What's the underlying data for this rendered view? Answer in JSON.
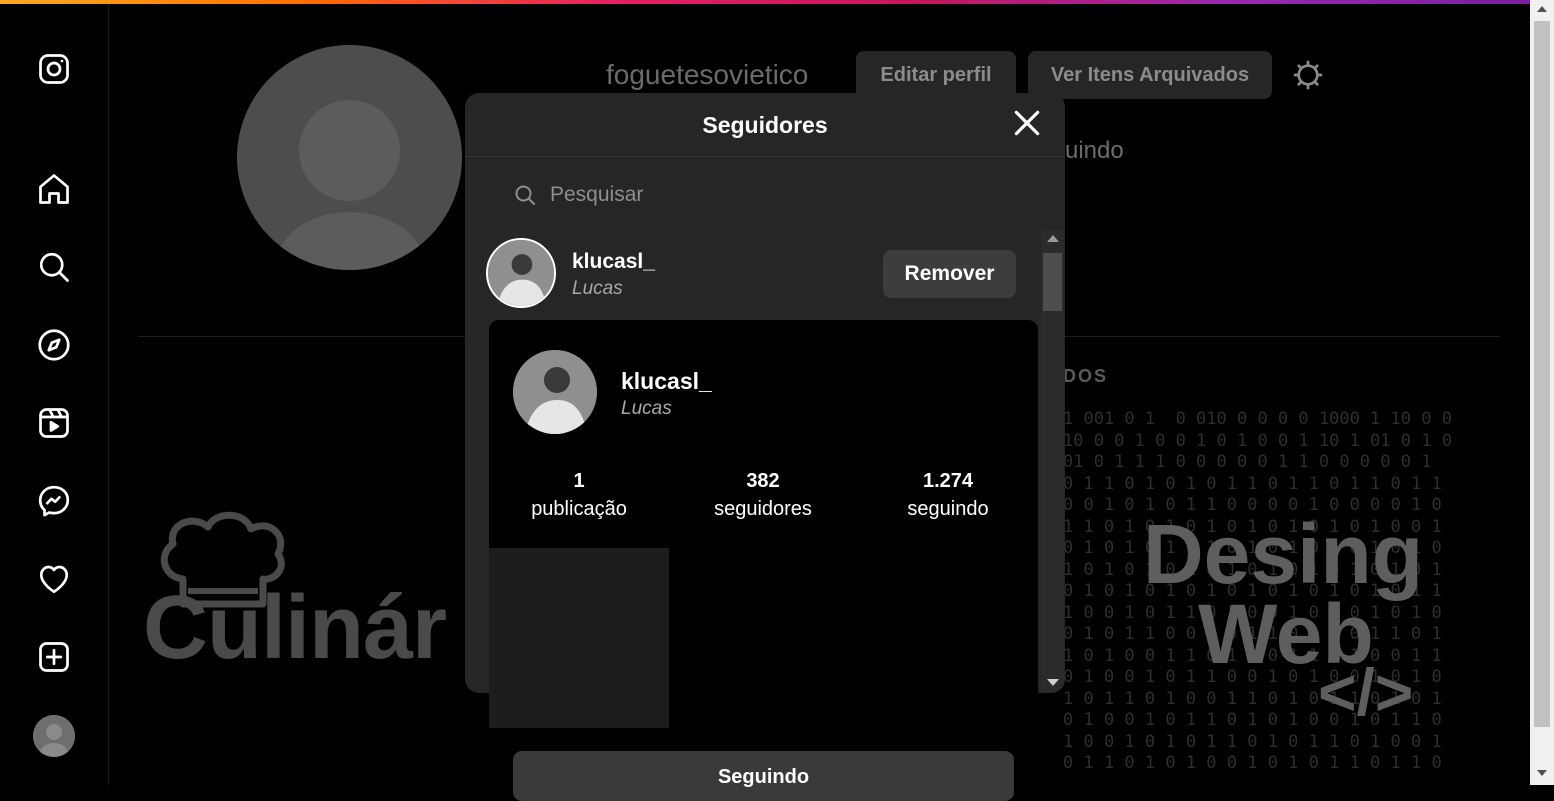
{
  "colors": {
    "background": "#000000",
    "modal": "#262626",
    "button": "#3d3d3d",
    "muted": "#a8a8a8"
  },
  "sidebar": {
    "icons": [
      "instagram-logo-icon",
      "home-icon",
      "search-icon",
      "explore-icon",
      "reels-icon",
      "messenger-icon",
      "heart-icon",
      "create-icon"
    ]
  },
  "profile": {
    "username": "foguetesovietico",
    "edit_label": "Editar perfil",
    "archive_label": "Ver Itens Arquivados",
    "following_fragment": "uindo",
    "tab_fragment": "DOS",
    "post1_text": "Culinár",
    "post2_line1": "Desing",
    "post2_line2": "Web",
    "post2_code": "</>"
  },
  "modal": {
    "title": "Seguidores",
    "search_placeholder": "Pesquisar",
    "follower": {
      "username": "klucasl_",
      "name": "Lucas",
      "remove_label": "Remover"
    }
  },
  "hover_card": {
    "username": "klucasl_",
    "name": "Lucas",
    "stats": [
      {
        "num": "1",
        "label": "publicação"
      },
      {
        "num": "382",
        "label": "seguidores"
      },
      {
        "num": "1.274",
        "label": "seguindo"
      }
    ],
    "following_button": "Seguindo"
  }
}
